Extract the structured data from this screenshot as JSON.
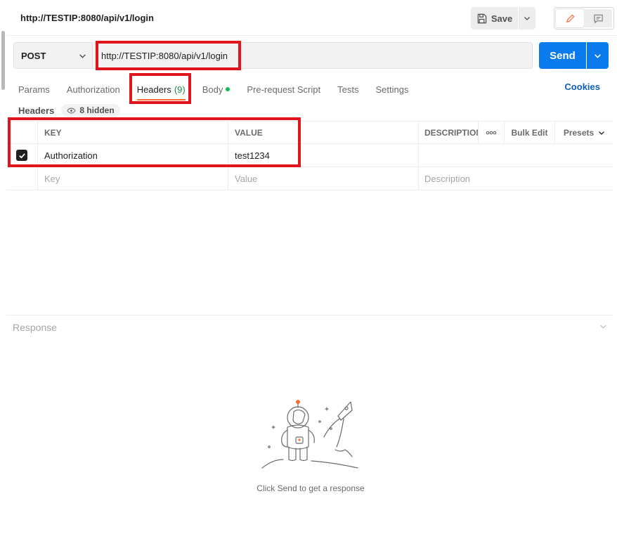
{
  "request": {
    "title": "http://TESTIP:8080/api/v1/login",
    "method": "POST",
    "url": "http://TESTIP:8080/api/v1/login"
  },
  "toolbar": {
    "save_label": "Save",
    "send_label": "Send"
  },
  "tabs": [
    {
      "label": "Params"
    },
    {
      "label": "Authorization"
    },
    {
      "label": "Headers",
      "count": "(9)"
    },
    {
      "label": "Body"
    },
    {
      "label": "Pre-request Script"
    },
    {
      "label": "Tests"
    },
    {
      "label": "Settings"
    }
  ],
  "cookies_label": "Cookies",
  "headers_section": {
    "label": "Headers",
    "hidden": "8 hidden"
  },
  "table": {
    "columns": {
      "key": "KEY",
      "value": "VALUE",
      "description": "DESCRIPTION",
      "bulk_edit": "Bulk Edit",
      "presets": "Presets"
    },
    "rows": [
      {
        "checked": true,
        "key": "Authorization",
        "value": "test1234"
      }
    ],
    "placeholders": {
      "key": "Key",
      "value": "Value",
      "description": "Description"
    }
  },
  "response": {
    "label": "Response",
    "empty_text": "Click Send to get a response"
  },
  "colors": {
    "primary": "#097bed",
    "accent": "#ff6c37",
    "annotation": "#e0151e",
    "link": "#0d5fbb"
  }
}
